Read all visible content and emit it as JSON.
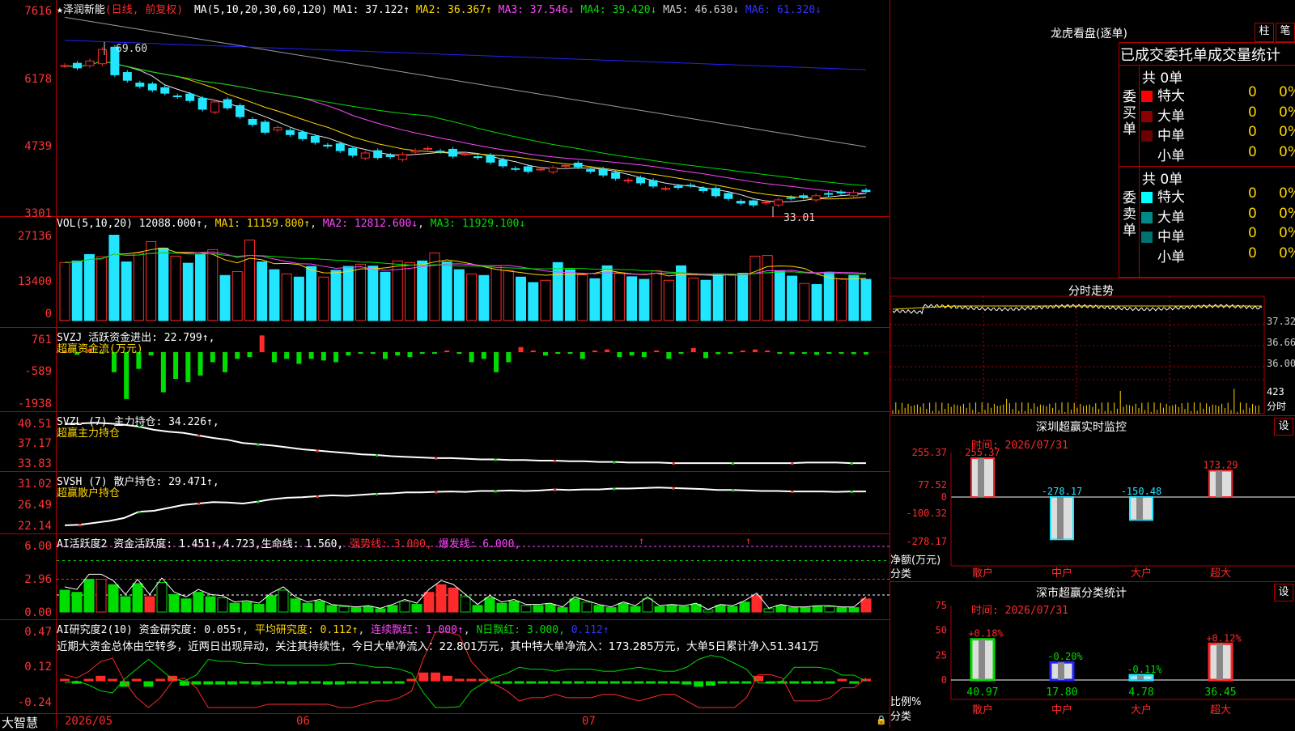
{
  "colors": {
    "up": "#ff2a2a",
    "down": "#22e6ff",
    "green": "#00dd00",
    "grid": "#b00000",
    "yellow": "#ffd700",
    "magenta": "#ff44ff",
    "white": "#e6e6e6",
    "blue": "#2222ff",
    "gray": "#9a9a9a"
  },
  "main": {
    "title": "★泽润新能",
    "mode": "(日线, 前复权)",
    "ma_label": "MA(5,10,20,30,60,120)",
    "ma": [
      {
        "t": "MA1: 37.122↑",
        "c": "#ffffff"
      },
      {
        "t": "MA2: 36.367↑",
        "c": "#ffd700"
      },
      {
        "t": "MA3: 37.546↓",
        "c": "#ff44ff"
      },
      {
        "t": "MA4: 39.420↓",
        "c": "#00dd00"
      },
      {
        "t": "MA5: 46.630↓",
        "c": "#cccccc"
      },
      {
        "t": "MA6: 61.320↓",
        "c": "#3333ff"
      }
    ],
    "y_labels": [
      "7616",
      "6178",
      "4739",
      "3301"
    ],
    "hi_label": "69.60",
    "lo_label": "33.01"
  },
  "vol": {
    "header": "VOL(5,10,20) 12088.000↑",
    "ma": [
      {
        "t": "MA1: 11159.800↑",
        "c": "#ffd700"
      },
      {
        "t": "MA2: 12812.600↓",
        "c": "#ff44ff"
      },
      {
        "t": "MA3: 11929.100↓",
        "c": "#00dd00"
      }
    ],
    "y_labels": [
      "27136",
      "13400",
      "0"
    ]
  },
  "svzj": {
    "header": "SVZJ  活跃资金进出: 22.799↑,",
    "sub": "超赢资金流(万元)",
    "y_labels": [
      "761",
      "-589",
      "-1938"
    ]
  },
  "svzl": {
    "header": "SVZL (7) 主力持仓: 34.226↑,",
    "sub": "超赢主力持仓",
    "y_labels": [
      "40.51",
      "37.17",
      "33.83"
    ]
  },
  "svsh": {
    "header": "SVSH (7) 散户持仓: 29.471↑,",
    "sub": "超赢散户持仓",
    "y_labels": [
      "31.02",
      "26.49",
      "22.14"
    ]
  },
  "ai1": {
    "header": "AI活跃度2 资金活跃度: 1.451↑,4.723,生命线: 1.560,",
    "h2": "强势线: 3.000,",
    "h3": "爆发线: 6.000,",
    "y_labels": [
      "6.00",
      "2.96",
      "0.00"
    ]
  },
  "ai2": {
    "header": "AI研究度2(10) 资金研究度: 0.055↑",
    "h2": "平均研究度: 0.112↑",
    "h3": "连续飘红: 1.000↑",
    "h4": "N日飘红: 3.000,",
    "h5": "0.112↑",
    "text": "近期大资金总体由空转多，近两日出现异动，关注其持续性，今日大单净流入：22.801万元，其中特大单净流入：173.285万元，大单5日累计净入51.341万",
    "y_labels": [
      "0.47",
      "0.12",
      "-0.24"
    ]
  },
  "footer": {
    "brand": "大智慧",
    "dates": [
      "2026/05",
      "06",
      "07"
    ]
  },
  "lhb": {
    "title": "龙虎看盘(逐单)",
    "btn1": "柱",
    "btn2": "笔",
    "subtitle": "已成交委托单成交量统计",
    "buy": {
      "side": "委买单",
      "total": "共 0单",
      "rows": [
        {
          "name": "特大",
          "v": "0",
          "p": "0%",
          "c": "#ff0000"
        },
        {
          "name": "大单",
          "v": "0",
          "p": "0%",
          "c": "#8b0000"
        },
        {
          "name": "中单",
          "v": "0",
          "p": "0%",
          "c": "#6b0000"
        },
        {
          "name": "小单",
          "v": "0",
          "p": "0%",
          "c": "#000"
        }
      ]
    },
    "sell": {
      "side": "委卖单",
      "total": "共 0单",
      "rows": [
        {
          "name": "特大",
          "v": "0",
          "p": "0%",
          "c": "#00ffff"
        },
        {
          "name": "大单",
          "v": "0",
          "p": "0%",
          "c": "#008b8b"
        },
        {
          "name": "中单",
          "v": "0",
          "p": "0%",
          "c": "#007070"
        },
        {
          "name": "小单",
          "v": "0",
          "p": "0%",
          "c": "#000"
        }
      ]
    }
  },
  "fenshi": {
    "title": "分时走势",
    "y_labels": [
      "37.32",
      "36.66",
      "36.00"
    ],
    "vol_label": "423",
    "unit": "分时"
  },
  "szjk": {
    "title": "深圳超赢实时监控",
    "btn": "设",
    "time": "时间: 2026/07/31",
    "y_labels": [
      "255.37",
      "77.52",
      "0",
      "-100.32",
      "-278.17"
    ],
    "ylab": "净额(万元)",
    "xlab": "分类",
    "bars": [
      {
        "name": "散户",
        "v": 255.37,
        "label": "255.37"
      },
      {
        "name": "中户",
        "v": -278.17,
        "label": "-278.17"
      },
      {
        "name": "大户",
        "v": -150.48,
        "label": "-150.48"
      },
      {
        "name": "超大",
        "v": 173.29,
        "label": "173.29"
      }
    ]
  },
  "szfl": {
    "title": "深市超赢分类统计",
    "btn": "设",
    "time": "时间: 2026/07/31",
    "y_labels": [
      "75",
      "50",
      "25",
      "0"
    ],
    "ylab": "比例%",
    "xlab": "分类",
    "bars": [
      {
        "name": "散户",
        "v": 40.97,
        "label": "40.97",
        "chg": "+0.18%"
      },
      {
        "name": "中户",
        "v": 17.8,
        "label": "17.80",
        "chg": "-0.20%"
      },
      {
        "name": "大户",
        "v": 4.78,
        "label": "4.78",
        "chg": "-0.11%"
      },
      {
        "name": "超大",
        "v": 36.45,
        "label": "36.45",
        "chg": "+0.12%"
      }
    ]
  },
  "chart_data": [
    {
      "type": "candlestick",
      "title": "泽润新能 日线",
      "ylim": [
        33.0,
        77.0
      ],
      "hi": 69.6,
      "lo": 33.01,
      "close": [
        64.5,
        64.0,
        65.5,
        68.0,
        62.5,
        61.3,
        60.0,
        59.2,
        58.5,
        57.8,
        56.9,
        55.0,
        56.6,
        55.3,
        53.4,
        51.7,
        50.0,
        51.0,
        49.5,
        48.6,
        47.8,
        47.0,
        46.0,
        45.0,
        45.5,
        44.5,
        44.7,
        45.2,
        46.0,
        46.5,
        45.8,
        44.8,
        45.3,
        44.5,
        43.5,
        42.7,
        42.0,
        41.5,
        42.0,
        42.3,
        42.8,
        42.5,
        41.5,
        40.7,
        40.0,
        39.6,
        39.0,
        38.3,
        37.8,
        38.0,
        38.4,
        37.3,
        36.2,
        35.6,
        34.6,
        34.2,
        34.8,
        35.3,
        35.7,
        35.9,
        36.2,
        36.5,
        36.8,
        36.9,
        37.1
      ]
    },
    {
      "type": "bar",
      "title": "VOL",
      "ylim": [
        0,
        27136
      ],
      "values": [
        18000,
        18500,
        20500,
        19800,
        26500,
        18200,
        21000,
        24500,
        22500,
        20000,
        17800,
        20500,
        22000,
        14000,
        15200,
        25000,
        18200,
        15800,
        14500,
        13500,
        16800,
        13500,
        15600,
        16800,
        17500,
        16900,
        15000,
        18500,
        18000,
        18500,
        21000,
        18200,
        15800,
        14500,
        14000,
        17000,
        15600,
        13500,
        11800,
        12500,
        18000,
        15800,
        14200,
        13000,
        17000,
        14800,
        13600,
        12800,
        15500,
        12500,
        17000,
        13200,
        12500,
        14500,
        14400,
        14700,
        20000,
        20200,
        15500,
        13800,
        11500,
        11200,
        14800,
        13000,
        14000,
        12800
      ]
    },
    {
      "type": "bar",
      "title": "SVZJ",
      "values": [
        30,
        -80,
        90,
        -30,
        -600,
        -1400,
        -500,
        -100,
        -1200,
        -800,
        -900,
        -700,
        -300,
        -600,
        -200,
        -150,
        500,
        -300,
        -200,
        -350,
        -200,
        -250,
        -300,
        -100,
        -30,
        -10,
        -200,
        -100,
        -150,
        -20,
        -30,
        40,
        -20,
        -300,
        -200,
        -600,
        -300,
        150,
        50,
        -100,
        -50,
        -30,
        -200,
        40,
        80,
        -150,
        -100,
        -150,
        20,
        -200,
        -50,
        120,
        -180,
        -60,
        -20,
        20,
        80,
        30,
        -40,
        -60,
        -30,
        -80,
        -10,
        -50,
        -60,
        -70
      ]
    },
    {
      "type": "line",
      "title": "SVZL",
      "ylim": [
        33.83,
        40.51
      ],
      "values": [
        40.4,
        40.5,
        40.6,
        40.5,
        40.3,
        40.0,
        39.5,
        39.2,
        39.0,
        38.6,
        38.2,
        37.9,
        37.4,
        37.2,
        37.0,
        36.7,
        36.4,
        36.2,
        36.0,
        35.8,
        35.6,
        35.5,
        35.3,
        35.2,
        35.1,
        35.0,
        35.0,
        34.9,
        34.8,
        34.8,
        34.7,
        34.7,
        34.6,
        34.6,
        34.5,
        34.5,
        34.4,
        34.4,
        34.3,
        34.3,
        34.3,
        34.2,
        34.2,
        34.2,
        34.2,
        34.2,
        34.2,
        34.2,
        34.2,
        34.2,
        34.3,
        34.3,
        34.3,
        34.2,
        34.2
      ]
    },
    {
      "type": "line",
      "title": "SVSH",
      "ylim": [
        22.14,
        31.02
      ],
      "values": [
        22.5,
        22.6,
        23.0,
        23.4,
        24.0,
        25.3,
        25.5,
        26.1,
        26.7,
        27.0,
        27.3,
        27.2,
        27.0,
        27.4,
        27.9,
        28.2,
        28.3,
        28.5,
        28.7,
        28.6,
        28.8,
        29.0,
        29.1,
        29.3,
        29.3,
        29.4,
        29.5,
        29.4,
        29.6,
        29.6,
        29.7,
        29.6,
        29.7,
        29.9,
        29.8,
        29.9,
        29.9,
        30.1,
        30.1,
        30.2,
        30.3,
        30.2,
        30.1,
        30.0,
        29.8,
        29.8,
        29.7,
        29.6,
        29.6,
        29.5,
        29.5,
        29.5,
        29.4,
        29.5,
        29.5
      ]
    },
    {
      "type": "bar",
      "title": "AI活跃度2",
      "ylim": [
        0,
        6
      ],
      "values": [
        2.0,
        1.8,
        3.0,
        3.0,
        2.5,
        1.4,
        2.6,
        1.4,
        2.7,
        1.6,
        1.2,
        1.8,
        1.4,
        1.3,
        0.8,
        0.9,
        0.7,
        1.5,
        2.0,
        1.2,
        0.8,
        1.0,
        0.6,
        0.5,
        0.4,
        0.5,
        0.3,
        0.6,
        1.0,
        0.7,
        1.8,
        2.5,
        2.2,
        1.4,
        0.6,
        1.3,
        0.8,
        1.0,
        0.6,
        0.6,
        0.7,
        0.4,
        1.2,
        0.9,
        0.6,
        0.4,
        0.8,
        0.5,
        1.2,
        0.5,
        0.6,
        0.5,
        0.7,
        0.2,
        0.6,
        0.5,
        0.9,
        1.5,
        0.3,
        0.6,
        0.4,
        0.4,
        0.5,
        0.5,
        0.4,
        0.4,
        1.2
      ]
    },
    {
      "type": "bar",
      "title": "AI研究度2",
      "ylim": [
        -0.24,
        0.47
      ],
      "values": [
        0.02,
        -0.01,
        0.02,
        0.05,
        0.0,
        -0.05,
        0.0,
        -0.05,
        0.0,
        0.05,
        -0.04,
        -0.03,
        -0.03,
        -0.03,
        -0.03,
        -0.02,
        -0.03,
        -0.02,
        -0.02,
        -0.03,
        -0.02,
        -0.02,
        -0.03,
        -0.03,
        -0.02,
        -0.02,
        -0.02,
        -0.02,
        -0.01,
        0.0,
        0.08,
        0.08,
        0.05,
        0.01,
        0.0,
        0.01,
        -0.02,
        -0.02,
        -0.02,
        -0.01,
        -0.02,
        -0.01,
        -0.02,
        -0.02,
        -0.01,
        -0.01,
        -0.02,
        -0.02,
        -0.02,
        -0.01,
        -0.01,
        -0.02,
        -0.03,
        -0.05,
        -0.04,
        -0.02,
        -0.02,
        -0.01,
        0.05,
        -0.02,
        -0.02,
        -0.02,
        -0.02,
        -0.02,
        -0.01,
        0.01,
        -0.02,
        0.02
      ]
    }
  ]
}
